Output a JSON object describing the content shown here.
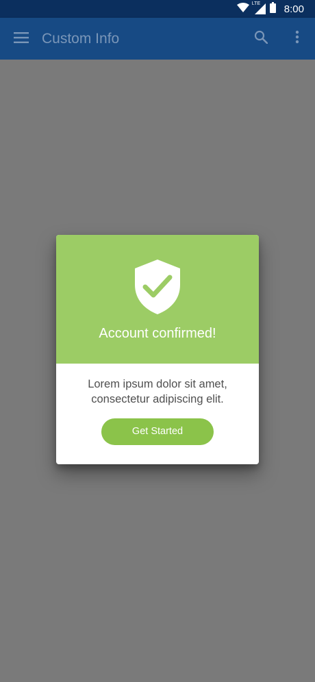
{
  "status_bar": {
    "time": "8:00",
    "network": "LTE",
    "icons": [
      "wifi-icon",
      "cellular-signal-icon",
      "battery-icon"
    ]
  },
  "app_bar": {
    "title": "Custom Info",
    "icons": [
      "menu-icon",
      "search-icon",
      "more-vert-icon"
    ]
  },
  "dialog": {
    "title": "Account confirmed!",
    "icon": "shield-check-icon",
    "body_line1": "Lorem ipsum dolor sit amet,",
    "body_line2": "consectetur adipiscing elit.",
    "button_label": "Get Started"
  },
  "colors": {
    "status_bar": "#0b2f5e",
    "app_bar": "#174a84",
    "scrim": "#7a7a7a",
    "dialog_header": "#9ccc65",
    "button": "#8bc34a"
  }
}
